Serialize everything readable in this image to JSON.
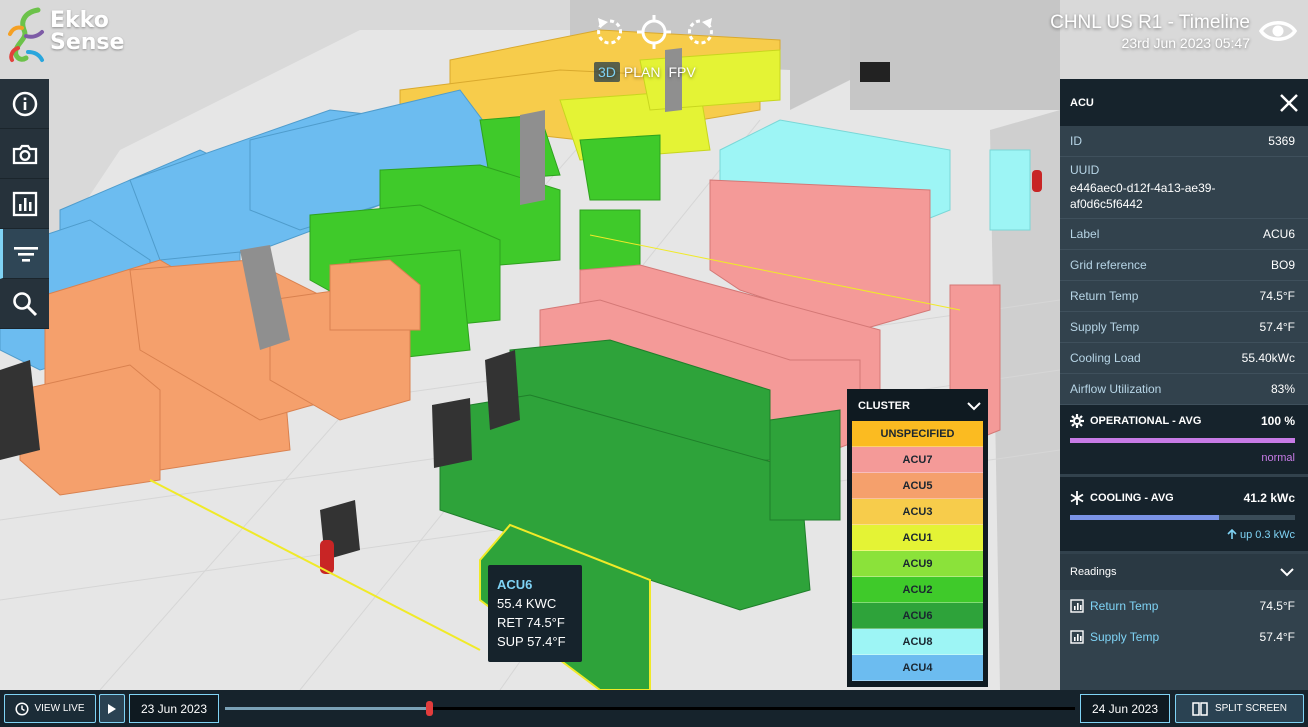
{
  "brand": {
    "name_line1": "Ekko",
    "name_line2": "Sense"
  },
  "header": {
    "title": "CHNL US R1 - Timeline",
    "timestamp": "23rd Jun 2023 05:47",
    "eye_icon": "eye-icon"
  },
  "view": {
    "tabs": [
      {
        "label": "3D",
        "active": true
      },
      {
        "label": "PLAN",
        "active": false
      },
      {
        "label": "FPV",
        "active": false
      }
    ]
  },
  "toolbar": {
    "items": [
      "info-icon",
      "camera-icon",
      "chart-icon",
      "filter-icon",
      "search-icon"
    ],
    "active": "filter-icon"
  },
  "panel": {
    "title": "ACU",
    "properties": [
      {
        "key": "ID",
        "value": "5369"
      },
      {
        "key": "UUID",
        "value": "e446aec0-d12f-4a13-ae39-af0d6c5f6442"
      },
      {
        "key": "Label",
        "value": "ACU6"
      },
      {
        "key": "Grid reference",
        "value": "BO9"
      },
      {
        "key": "Return Temp",
        "value": "74.5°F"
      },
      {
        "key": "Supply Temp",
        "value": "57.4°F"
      },
      {
        "key": "Cooling Load",
        "value": "55.40kWc"
      },
      {
        "key": "Airflow Utilization",
        "value": "83%"
      }
    ],
    "operational": {
      "label": "OPERATIONAL - AVG",
      "value": "100 %",
      "fill_fraction": 1.0,
      "status": "normal",
      "color": "#c77be6"
    },
    "cooling": {
      "label": "COOLING - AVG",
      "value": "41.2 kWc",
      "fill_fraction": 0.66,
      "trend": "up 0.3 kWc",
      "color": "#7a93e6"
    },
    "readings": {
      "title": "Readings",
      "items": [
        {
          "label": "Return Temp",
          "value": "74.5°F"
        },
        {
          "label": "Supply Temp",
          "value": "57.4°F"
        }
      ]
    }
  },
  "cluster": {
    "title": "CLUSTER",
    "items": [
      {
        "label": "UNSPECIFIED",
        "color": "#fbbb21"
      },
      {
        "label": "ACU7",
        "color": "#f49a98"
      },
      {
        "label": "ACU5",
        "color": "#f5a06c"
      },
      {
        "label": "ACU3",
        "color": "#f7cc4b"
      },
      {
        "label": "ACU1",
        "color": "#e4f335"
      },
      {
        "label": "ACU9",
        "color": "#8be23a"
      },
      {
        "label": "ACU2",
        "color": "#3fca2a"
      },
      {
        "label": "ACU6",
        "color": "#2ea33a"
      },
      {
        "label": "ACU8",
        "color": "#9df5f5"
      },
      {
        "label": "ACU4",
        "color": "#6cbcf0"
      }
    ]
  },
  "tooltip": {
    "title": "ACU6",
    "load": "55.4 KWC",
    "ret": "RET 74.5°F",
    "sup": "SUP 57.4°F"
  },
  "timeline": {
    "view_live": "VIEW LIVE",
    "start_date": "23 Jun 2023",
    "end_date": "24 Jun 2023",
    "split_screen": "SPLIT SCREEN",
    "progress_fraction": 0.24
  }
}
